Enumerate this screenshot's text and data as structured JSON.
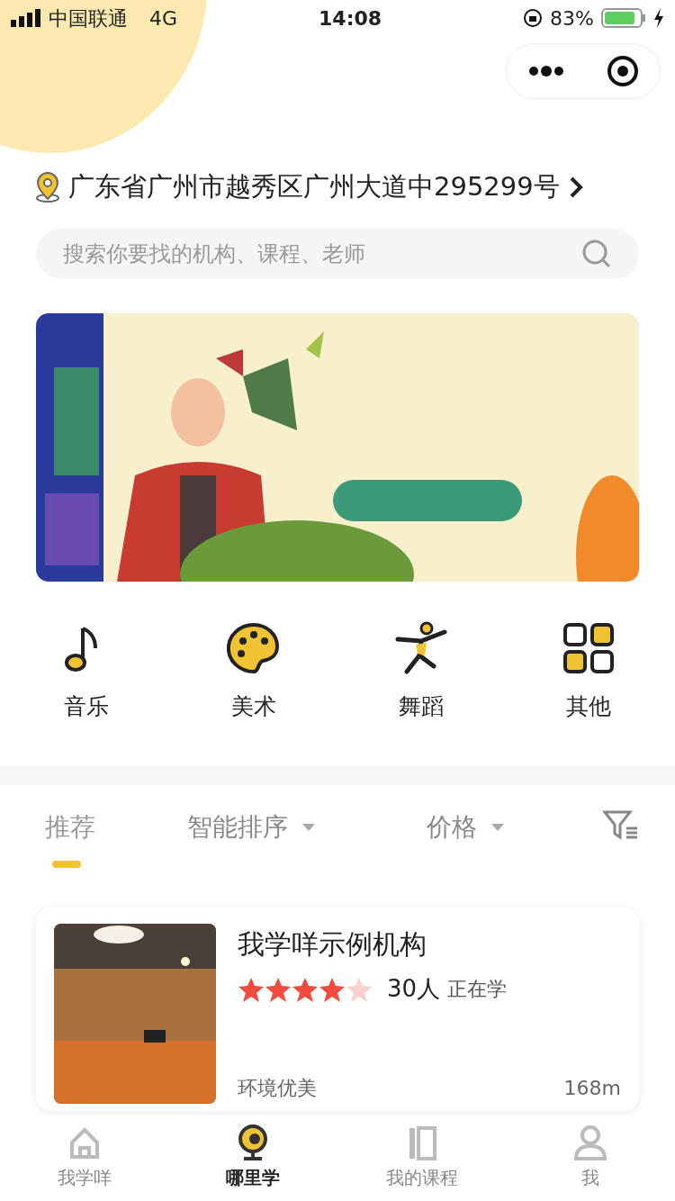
{
  "status_bar": {
    "carrier": "中国联通",
    "network": "4G",
    "time": "14:08",
    "battery": "83%"
  },
  "location": {
    "address": "广东省广州市越秀区广州大道中295299号"
  },
  "search": {
    "placeholder": "搜索你要找的机构、课程、老师"
  },
  "categories": [
    {
      "label": "音乐",
      "kind": "music"
    },
    {
      "label": "美术",
      "kind": "palette"
    },
    {
      "label": "舞蹈",
      "kind": "dance"
    },
    {
      "label": "其他",
      "kind": "grid"
    }
  ],
  "sort_tabs": [
    {
      "label": "推荐",
      "selected": true,
      "dropdown": false
    },
    {
      "label": "智能排序",
      "selected": false,
      "dropdown": true
    },
    {
      "label": "价格",
      "selected": false,
      "dropdown": true
    }
  ],
  "listings": [
    {
      "name": "我学咩示例机构",
      "stars": 4,
      "learners": "30人",
      "learners_label": "正在学",
      "tag": "环境优美",
      "distance": "168m"
    }
  ],
  "tab_bar": [
    {
      "label": "我学咩",
      "kind": "home",
      "selected": false
    },
    {
      "label": "哪里学",
      "kind": "pin",
      "selected": true
    },
    {
      "label": "我的课程",
      "kind": "book",
      "selected": false
    },
    {
      "label": "我",
      "kind": "person",
      "selected": false
    }
  ]
}
